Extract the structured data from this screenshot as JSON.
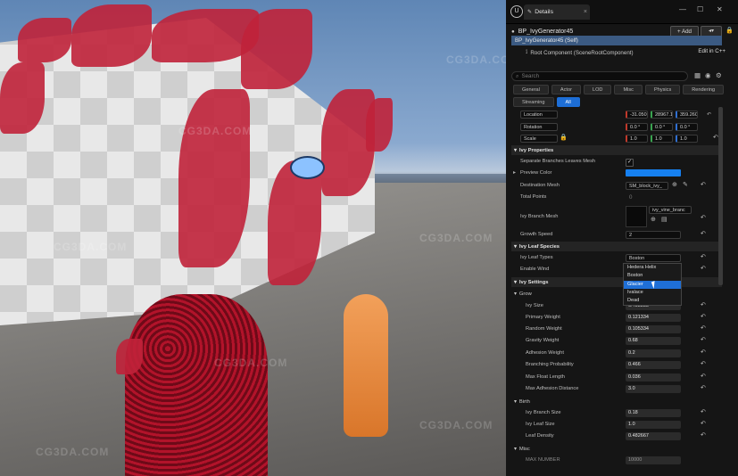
{
  "viewport": {
    "watermarks": [
      "CG3DA.COM",
      "CG3DA.COM",
      "CG3DA.COM",
      "CG3DA.COM",
      "CG3DA.COM",
      "CG3DA.COM",
      "CG3DA.COM"
    ]
  },
  "panel": {
    "tab_title": "Details",
    "blueprint_name": "BP_IvyGenerator45",
    "add_label": "+ Add",
    "component_self": "BP_IvyGenerator45 (Self)",
    "component_root": "Root Component (SceneRootComponent)",
    "edit_cpp": "Edit in C++",
    "search_placeholder": "Search",
    "filters": [
      "General",
      "Actor",
      "LOD",
      "Misc",
      "Physics",
      "Rendering",
      "Streaming",
      "All"
    ],
    "active_filter": "All"
  },
  "transform": {
    "location": {
      "label": "Location",
      "x": "-31.050",
      "y": "28967.1",
      "z": "359.260"
    },
    "rotation": {
      "label": "Rotation",
      "x": "0.0 °",
      "y": "0.0 °",
      "z": "0.0 °"
    },
    "scale": {
      "label": "Scale",
      "x": "1.0",
      "y": "1.0",
      "z": "1.0"
    }
  },
  "ivy_properties": {
    "header": "Ivy Properties",
    "separate_label": "Separate Branches Leaves Mesh",
    "separate_checked": "✓",
    "preview_color_label": "Preview Color",
    "preview_color": "#1680f0",
    "destination_mesh_label": "Destination Mesh",
    "destination_mesh_value": "SM_block_ivy_",
    "total_points_label": "Total Points",
    "total_points_value": "0",
    "branch_mesh_label": "Ivy Branch Mesh",
    "branch_mesh_value": "ivy_vine_branc",
    "growth_speed_label": "Growth Speed",
    "growth_speed_value": "2"
  },
  "leaf_species": {
    "header": "Ivy Leaf Species",
    "types_label": "Ivy Leaf Types",
    "types_value": "Boston",
    "enable_wind_label": "Enable Wind",
    "options": [
      "Hedera Helix",
      "Boston",
      "Glacier",
      "Ivalace",
      "Dead"
    ],
    "highlighted": "Glacier"
  },
  "ivy_settings": {
    "header": "Ivy Settings",
    "grow_header": "Grow",
    "grow": [
      {
        "label": "Ivy Size",
        "value": "6.453335"
      },
      {
        "label": "Primary Weight",
        "value": "0.121334"
      },
      {
        "label": "Random Weight",
        "value": "0.105334"
      },
      {
        "label": "Gravity Weight",
        "value": "0.68"
      },
      {
        "label": "Adhesion Weight",
        "value": "0.2"
      },
      {
        "label": "Branching Probability",
        "value": "0.466"
      },
      {
        "label": "Max Float Length",
        "value": "0.036"
      },
      {
        "label": "Max Adhesion Distance",
        "value": "3.0"
      }
    ],
    "birth_header": "Birth",
    "birth": [
      {
        "label": "Ivy Branch Size",
        "value": "0.18"
      },
      {
        "label": "Ivy Leaf Size",
        "value": "1.0"
      },
      {
        "label": "Leaf Density",
        "value": "0.482667"
      }
    ],
    "misc_header": "Misc",
    "misc": [
      {
        "label": "MAX NUMBER",
        "value": "10000"
      }
    ]
  }
}
